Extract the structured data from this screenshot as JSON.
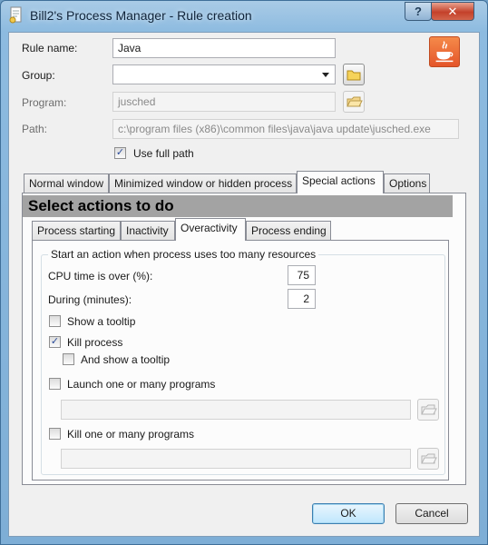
{
  "window": {
    "title": "Bill2's Process Manager - Rule creation",
    "help_label": "?",
    "close_label": "✕"
  },
  "form": {
    "rule_name_label": "Rule name:",
    "rule_name_value": "Java",
    "group_label": "Group:",
    "group_value": "",
    "program_label": "Program:",
    "program_value": "jusched",
    "path_label": "Path:",
    "path_value": "c:\\program files (x86)\\common files\\java\\java update\\jusched.exe",
    "use_full_path_label": "Use full path",
    "use_full_path_checked": true
  },
  "main_tabs": [
    {
      "label": "Normal window"
    },
    {
      "label": "Minimized window or hidden process"
    },
    {
      "label": "Special actions"
    },
    {
      "label": "Options"
    }
  ],
  "section_title": "Select actions to do",
  "sub_tabs": [
    {
      "label": "Process starting"
    },
    {
      "label": "Inactivity"
    },
    {
      "label": "Overactivity"
    },
    {
      "label": "Process ending"
    }
  ],
  "overactivity": {
    "group_caption": "Start an action when process uses too many resources",
    "cpu_label": "CPU time is over (%):",
    "cpu_value": "75",
    "during_label": "During (minutes):",
    "during_value": "2",
    "show_tooltip_label": "Show a tooltip",
    "show_tooltip_checked": false,
    "kill_process_label": "Kill process",
    "kill_process_checked": true,
    "and_show_tooltip_label": "And show a tooltip",
    "and_show_tooltip_checked": false,
    "launch_programs_label": "Launch one or many programs",
    "launch_programs_checked": false,
    "launch_programs_value": "",
    "kill_programs_label": "Kill one or many programs",
    "kill_programs_checked": false,
    "kill_programs_value": ""
  },
  "footer": {
    "ok_label": "OK",
    "cancel_label": "Cancel"
  },
  "colors": {
    "accent": "#e4552a",
    "window_frame": "#8dbbe0",
    "section_header": "#a3a3a3"
  }
}
